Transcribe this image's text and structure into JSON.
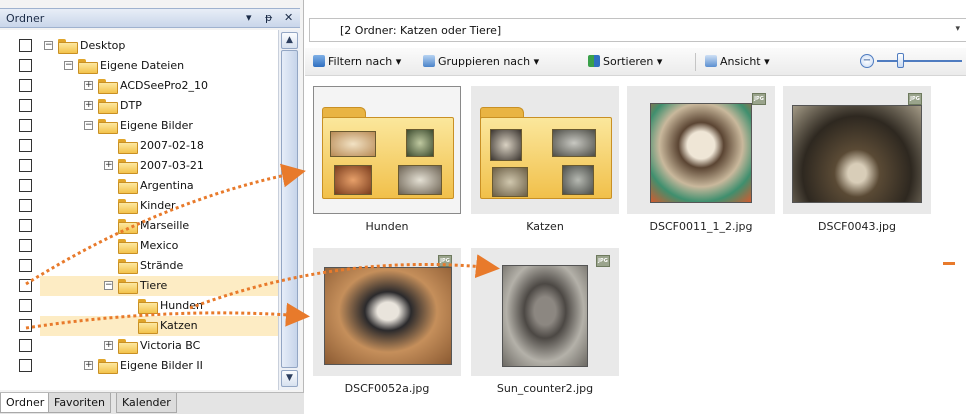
{
  "left_pane": {
    "title": "Ordner",
    "header_buttons": {
      "menu": "▾",
      "pin": "ᵽ",
      "close": "✕"
    },
    "tree": [
      {
        "label": "Desktop",
        "depth": 0,
        "expander": "−",
        "selected": false
      },
      {
        "label": "Eigene Dateien",
        "depth": 1,
        "expander": "−",
        "selected": false
      },
      {
        "label": "ACDSeePro2_10",
        "depth": 2,
        "expander": "+",
        "selected": false
      },
      {
        "label": "DTP",
        "depth": 2,
        "expander": "+",
        "selected": false
      },
      {
        "label": "Eigene Bilder",
        "depth": 2,
        "expander": "−",
        "selected": false
      },
      {
        "label": "2007-02-18",
        "depth": 3,
        "expander": "",
        "selected": false
      },
      {
        "label": "2007-03-21",
        "depth": 3,
        "expander": "+",
        "selected": false
      },
      {
        "label": "Argentina",
        "depth": 3,
        "expander": "",
        "selected": false
      },
      {
        "label": "Kinder",
        "depth": 3,
        "expander": "",
        "selected": false
      },
      {
        "label": "Marseille",
        "depth": 3,
        "expander": "",
        "selected": false
      },
      {
        "label": "Mexico",
        "depth": 3,
        "expander": "",
        "selected": false
      },
      {
        "label": "Strände",
        "depth": 3,
        "expander": "",
        "selected": false
      },
      {
        "label": "Tiere",
        "depth": 3,
        "expander": "−",
        "selected": true
      },
      {
        "label": "Hunden",
        "depth": 4,
        "expander": "",
        "selected": false
      },
      {
        "label": "Katzen",
        "depth": 4,
        "expander": "",
        "selected": true
      },
      {
        "label": "Victoria BC",
        "depth": 3,
        "expander": "+",
        "selected": false
      },
      {
        "label": "Eigene Bilder II",
        "depth": 2,
        "expander": "+",
        "selected": false
      }
    ],
    "bottom_tabs": [
      "Ordner",
      "Favoriten",
      "Kalender"
    ],
    "active_tab": "Ordner"
  },
  "right_pane": {
    "path": "[2 Ordner: Katzen oder Tiere]",
    "toolbar": {
      "filter": "Filtern nach",
      "group": "Gruppieren nach",
      "sort": "Sortieren",
      "view": "Ansicht",
      "dropdown_glyph": "▾"
    },
    "zoom_glyph": "−",
    "items": [
      {
        "name": "Hunden",
        "kind": "folder",
        "selected": true
      },
      {
        "name": "Katzen",
        "kind": "folder",
        "selected": false
      },
      {
        "name": "DSCF0011_1_2.jpg",
        "kind": "image",
        "selected": false
      },
      {
        "name": "DSCF0043.jpg",
        "kind": "image",
        "selected": false
      },
      {
        "name": "DSCF0052a.jpg",
        "kind": "image",
        "selected": false
      },
      {
        "name": "Sun_counter2.jpg",
        "kind": "image",
        "selected": false
      }
    ]
  },
  "colors": {
    "accent_arrow": "#e87a2b",
    "selection": "#fdecc4",
    "folder": "#f3c24b"
  }
}
